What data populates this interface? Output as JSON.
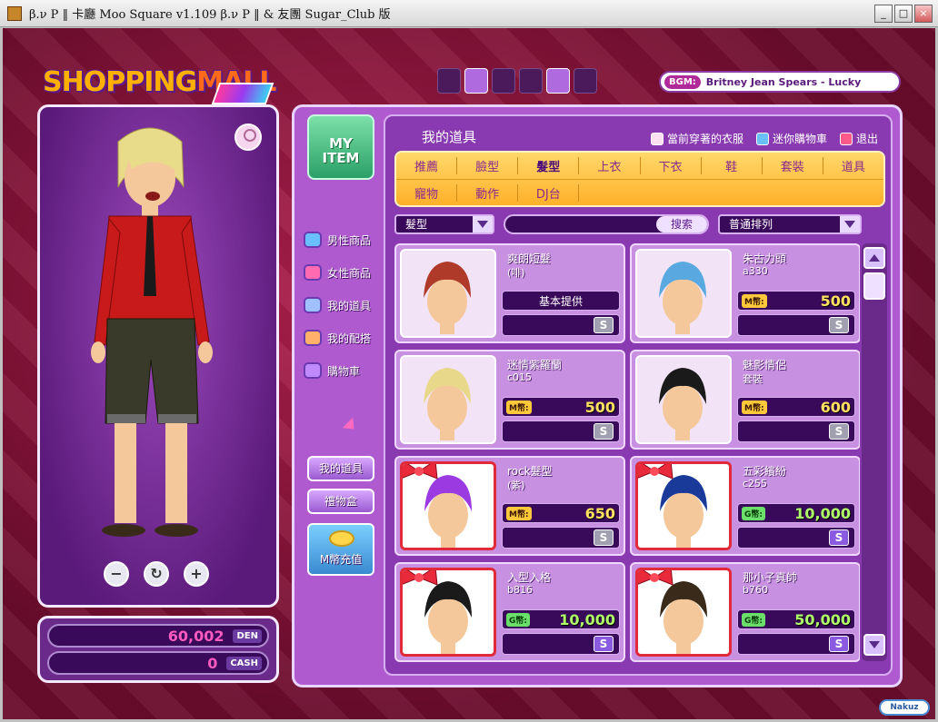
{
  "window": {
    "title": "β.ν P ‖ 卡廳  Moo Square  v1.109  β.ν P ‖ & 友團 Sugar_Club 版",
    "minimize": "_",
    "maximize": "□",
    "close": "×"
  },
  "logo": {
    "word1": "SHOPPING",
    "word2": "MALL"
  },
  "bgm": {
    "label": "BGM:",
    "song": "Britney Jean Spears - Lucky"
  },
  "currency": [
    {
      "value": "60,002",
      "unit": "DEN"
    },
    {
      "value": "0",
      "unit": "CASH"
    }
  ],
  "avatar_controls": {
    "zoom_out": "−",
    "rotate": "↻",
    "zoom_in": "+"
  },
  "my_item_badge": "MY ITEM",
  "side_menu": [
    {
      "label": "男性商品",
      "icon": "male-icon"
    },
    {
      "label": "女性商品",
      "icon": "female-icon"
    },
    {
      "label": "我的道具",
      "icon": "items-icon"
    },
    {
      "label": "我的配搭",
      "icon": "outfit-icon"
    },
    {
      "label": "購物車",
      "icon": "cart-icon"
    }
  ],
  "side_buttons": {
    "my_items": "我的道具",
    "gift_box": "禮物盒",
    "recharge": "M幣充值"
  },
  "panel_title": "我的道具",
  "top_links": {
    "wearing": "當前穿著的衣服",
    "mini_cart": "迷你購物車",
    "exit": "退出"
  },
  "tabs_row1": [
    "推薦",
    "臉型",
    "髮型",
    "上衣",
    "下衣",
    "鞋",
    "套裝",
    "道具"
  ],
  "tabs_row2": [
    "寵物",
    "動作",
    "DJ台",
    "",
    "",
    "",
    "",
    ""
  ],
  "active_tab": "髮型",
  "filter": {
    "category": "髮型",
    "search_button": "搜索",
    "sort": "普通排列"
  },
  "items": [
    {
      "name": "爽朗短髮",
      "sub": "(啡)",
      "price_label": "",
      "price": "",
      "free_text": "基本提供",
      "s_label": "S",
      "gift": false,
      "hair": "#b03a2a"
    },
    {
      "name": "朱古力頭",
      "sub": "a330",
      "price_label": "M幣:",
      "price": "500",
      "free_text": "",
      "s_label": "S",
      "gift": false,
      "hair": "#5aa8e0"
    },
    {
      "name": "迷情紫羅蘭",
      "sub": "c015",
      "price_label": "M幣:",
      "price": "500",
      "free_text": "",
      "s_label": "S",
      "gift": false,
      "hair": "#e8d88a"
    },
    {
      "name": "魅影情侶",
      "sub": "套裝",
      "price_label": "M幣:",
      "price": "600",
      "free_text": "",
      "s_label": "S",
      "gift": false,
      "hair": "#1a1a1a"
    },
    {
      "name": "rock髮型",
      "sub": "(紫)",
      "price_label": "M幣:",
      "price": "650",
      "free_text": "",
      "s_label": "S",
      "gift": true,
      "hair": "#9a3ae0"
    },
    {
      "name": "五彩繽紛",
      "sub": "c255",
      "price_label": "G幣:",
      "price": "10,000",
      "free_text": "",
      "s_label": "S",
      "gift": true,
      "hair": "#1a3a9a"
    },
    {
      "name": "入型入格",
      "sub": "b816",
      "price_label": "G幣:",
      "price": "10,000",
      "free_text": "",
      "s_label": "S",
      "gift": true,
      "hair": "#1a1a1a"
    },
    {
      "name": "那小子真帥",
      "sub": "b760",
      "price_label": "G幣:",
      "price": "50,000",
      "free_text": "",
      "s_label": "S",
      "gift": true,
      "hair": "#3a2a1a"
    }
  ],
  "footer": "Nakuz"
}
